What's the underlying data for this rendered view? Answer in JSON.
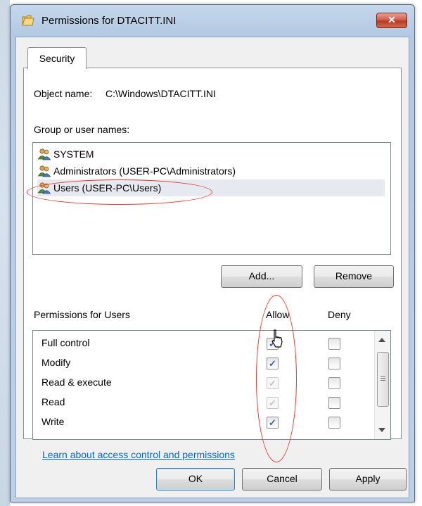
{
  "window": {
    "title": "Permissions for DTACITT.INI",
    "title_icon": "folder-icon",
    "close_glyph": "✕"
  },
  "tabs": [
    {
      "label": "Security",
      "active": true
    }
  ],
  "object": {
    "label": "Object name:",
    "value": "C:\\Windows\\DTACITT.INI"
  },
  "groups": {
    "label": "Group or user names:",
    "items": [
      {
        "label": "SYSTEM",
        "icon": "users-icon",
        "selected": false
      },
      {
        "label": "Administrators (USER-PC\\Administrators)",
        "icon": "users-icon",
        "selected": false
      },
      {
        "label": "Users (USER-PC\\Users)",
        "icon": "users-icon",
        "selected": true
      }
    ],
    "add_label": "Add...",
    "remove_label": "Remove"
  },
  "permissions": {
    "label": "Permissions for Users",
    "allow_label": "Allow",
    "deny_label": "Deny",
    "rows": [
      {
        "name": "Full control",
        "allow": true,
        "allow_disabled": false,
        "deny": false
      },
      {
        "name": "Modify",
        "allow": true,
        "allow_disabled": false,
        "deny": false
      },
      {
        "name": "Read & execute",
        "allow": true,
        "allow_disabled": true,
        "deny": false
      },
      {
        "name": "Read",
        "allow": true,
        "allow_disabled": true,
        "deny": false
      },
      {
        "name": "Write",
        "allow": true,
        "allow_disabled": false,
        "deny": false
      }
    ],
    "check_glyph": "✓"
  },
  "link": "Learn about access control and permissions",
  "buttons": {
    "ok": "OK",
    "cancel": "Cancel",
    "apply": "Apply"
  },
  "colors": {
    "annotation": "#e8382f",
    "link": "#0066cc",
    "selection": "#e6eaf0"
  }
}
